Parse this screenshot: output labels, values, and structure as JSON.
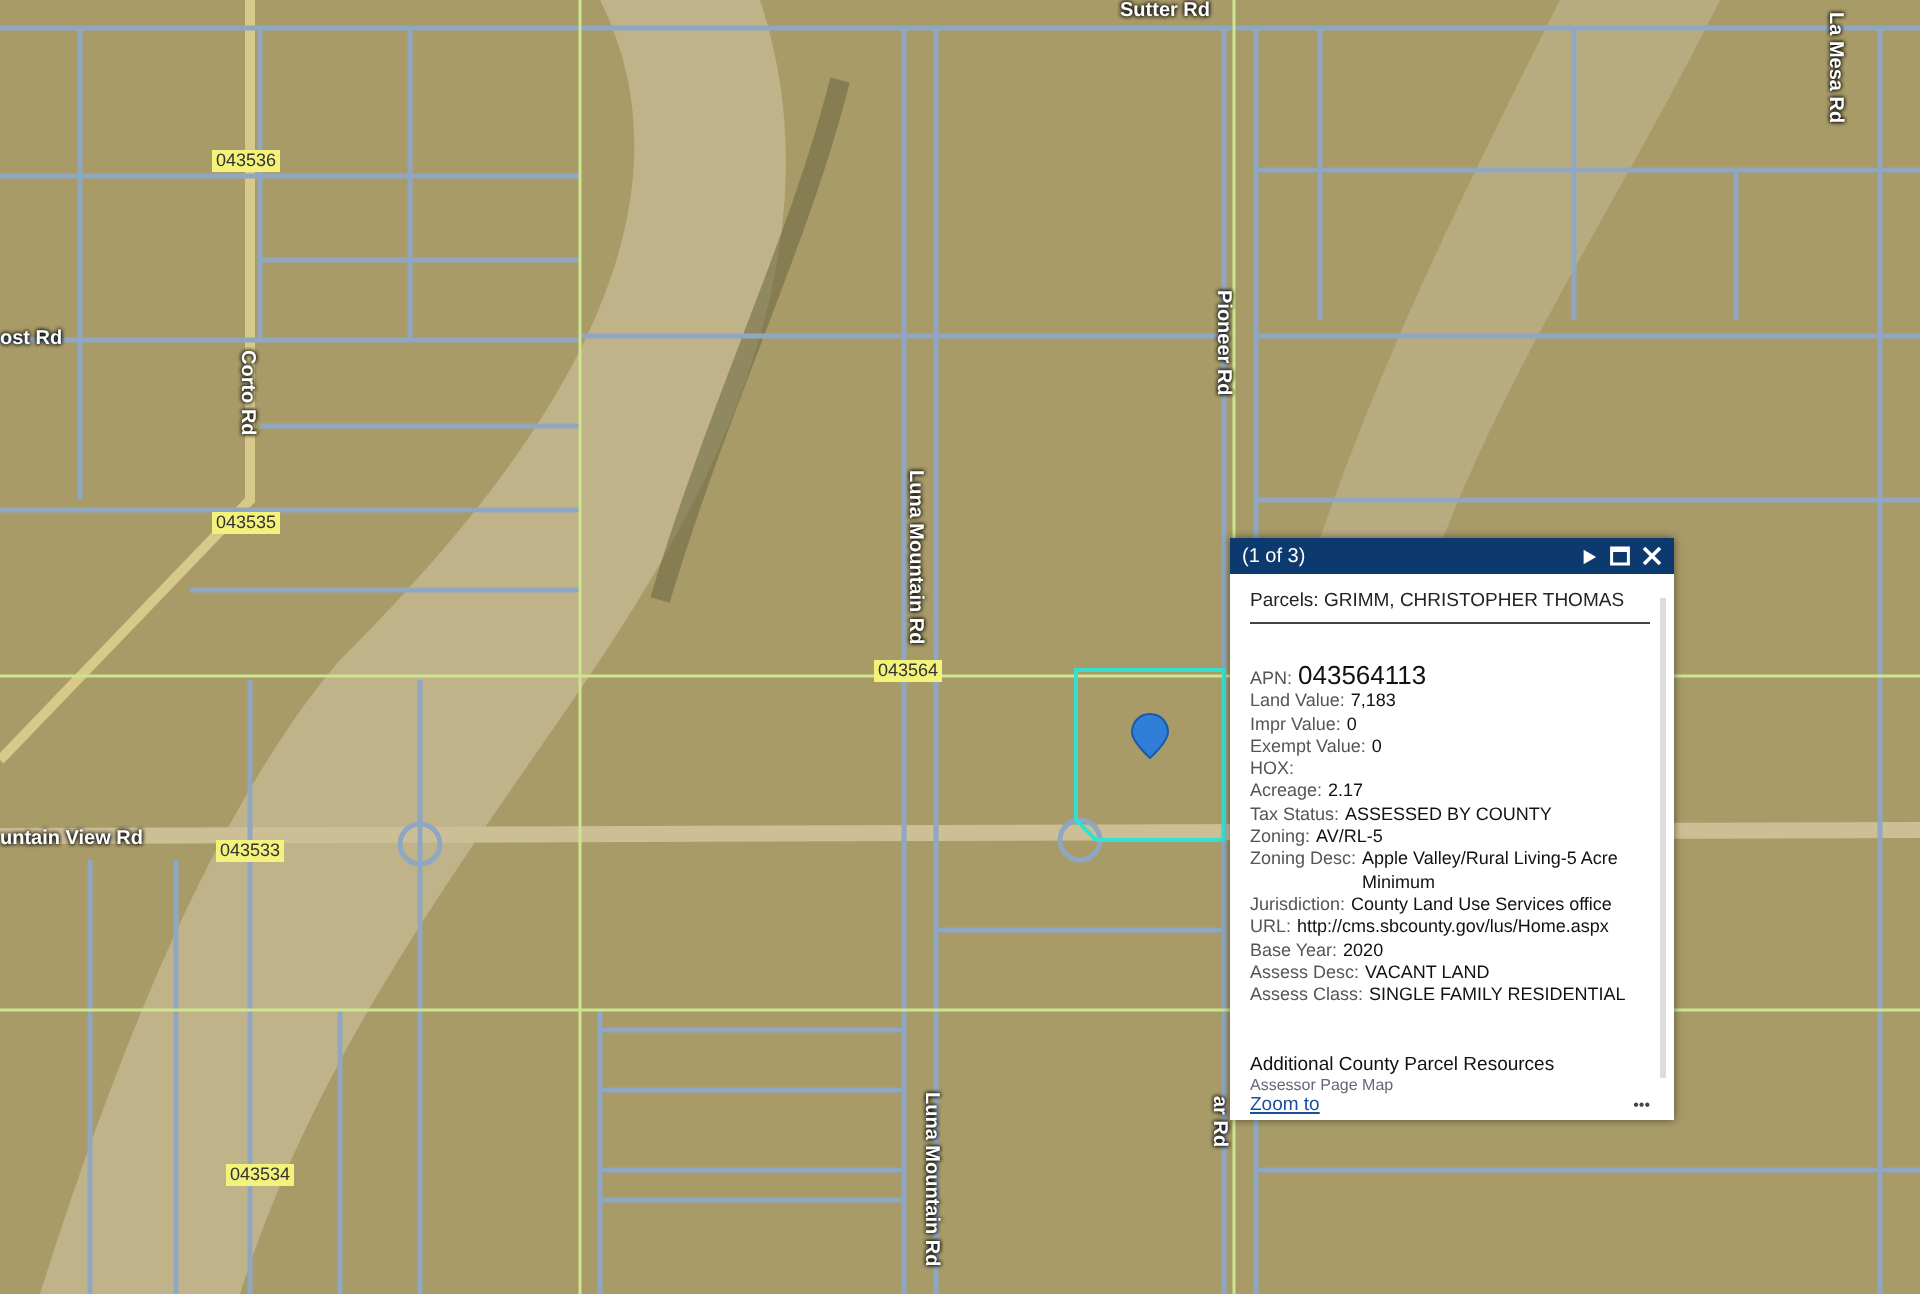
{
  "map": {
    "road_labels": [
      "Sutter Rd",
      "ost Rd",
      "Corto Rd",
      "Luna Mountain Rd",
      "untain View Rd",
      "Luna Mountain Rd",
      "Pioneer Rd",
      "La Mesa Rd",
      "ar Rd"
    ],
    "parcel_labels": [
      "043536",
      "043535",
      "043564",
      "043533",
      "043534"
    ]
  },
  "popup": {
    "counter": "(1 of 3)",
    "title": "Parcels: GRIMM, CHRISTOPHER THOMAS",
    "fields": [
      {
        "label": "APN:",
        "value": "043564113",
        "kind": "large"
      },
      {
        "label": "Land Value:",
        "value": "7,183",
        "kind": "normal"
      },
      {
        "label": "Impr Value:",
        "value": "0",
        "kind": "normal"
      },
      {
        "label": "Exempt Value:",
        "value": "0",
        "kind": "normal"
      },
      {
        "label": "HOX:",
        "kind": "normal"
      },
      {
        "label": "Acreage:",
        "value": "2.17",
        "kind": "normal"
      },
      {
        "label": "Tax Status:",
        "value": "ASSESSED BY COUNTY",
        "kind": "normal"
      },
      {
        "label": "Zoning:",
        "value": "AV/RL-5",
        "kind": "normal"
      },
      {
        "label": "Zoning Desc:",
        "value": "Apple Valley/Rural Living-5 Acre Minimum",
        "kind": "normal"
      },
      {
        "label": "Jurisdiction:",
        "value": "County Land Use Services office",
        "kind": "normal"
      },
      {
        "label": "URL:",
        "value": "http://cms.sbcounty.gov/lus/Home.aspx",
        "kind": "normal"
      },
      {
        "label": "Base Year:",
        "value": "2020",
        "kind": "normal"
      },
      {
        "label": "Assess Desc:",
        "value": "VACANT LAND",
        "kind": "normal"
      },
      {
        "label": "Assess Class:",
        "value": "SINGLE FAMILY RESIDENTIAL",
        "kind": "normal"
      }
    ],
    "resources_heading": "Additional County Parcel Resources",
    "resource_links": [
      "Assessor Page Map"
    ],
    "zoom_link": "Zoom to",
    "more": "•••"
  }
}
